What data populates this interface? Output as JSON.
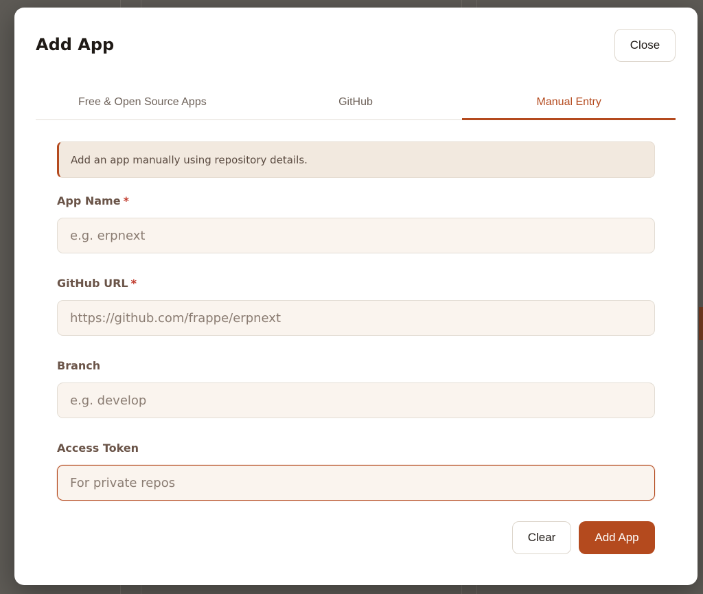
{
  "modal": {
    "title": "Add App",
    "close_label": "Close"
  },
  "tabs": [
    {
      "label": "Free & Open Source Apps",
      "active": false
    },
    {
      "label": "GitHub",
      "active": false
    },
    {
      "label": "Manual Entry",
      "active": true
    }
  ],
  "info_banner": "Add an app manually using repository details.",
  "form": {
    "app_name": {
      "label": "App Name",
      "required_mark": "*",
      "placeholder": "e.g. erpnext",
      "value": ""
    },
    "github_url": {
      "label": "GitHub URL",
      "required_mark": "*",
      "placeholder": "https://github.com/frappe/erpnext",
      "value": ""
    },
    "branch": {
      "label": "Branch",
      "placeholder": "e.g. develop",
      "value": ""
    },
    "access_token": {
      "label": "Access Token",
      "placeholder": "For private repos",
      "value": ""
    }
  },
  "actions": {
    "clear_label": "Clear",
    "add_label": "Add App"
  },
  "colors": {
    "accent": "#b44a1e",
    "overlay": "#5e5b56"
  }
}
